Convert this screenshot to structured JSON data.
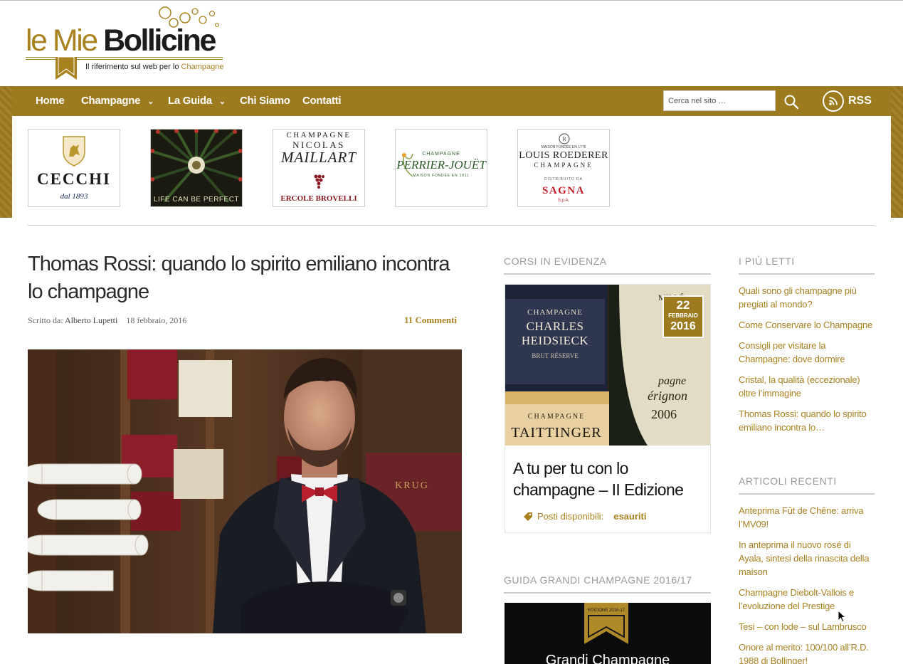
{
  "site": {
    "logo": {
      "word1": "le Mie ",
      "word2": "Bollicine",
      "tagline_prefix": "Il riferimento sul web per lo ",
      "tagline_highlight": "Champagne"
    }
  },
  "nav": {
    "items": [
      {
        "label": "Home",
        "has_submenu": false
      },
      {
        "label": "Champagne",
        "has_submenu": true
      },
      {
        "label": "La Guida",
        "has_submenu": true
      },
      {
        "label": "Chi Siamo",
        "has_submenu": false
      },
      {
        "label": "Contatti",
        "has_submenu": false
      }
    ],
    "search_placeholder": "Cerca nel sito …",
    "rss_label": "RSS"
  },
  "sponsors": {
    "cecchi": {
      "name": "CECCHI",
      "since": "dal 1893"
    },
    "perfect": {
      "text": "LIFE CAN BE PERFECT"
    },
    "maillart": {
      "line1": "CHAMPAGNE",
      "line2": "NICOLAS",
      "line3": "MAILLART",
      "line4": "ERCOLE BROVELLI"
    },
    "perrier": {
      "line1": "CHAMPAGNE",
      "line2": "PERRIER-JOUËT",
      "line3": "MAISON FONDÉE EN 1811"
    },
    "roederer": {
      "line0": "MAISON FONDÉE EN 1776",
      "line1": "LOUIS ROEDERER",
      "line2": "CHAMPAGNE",
      "line3": "DISTRIBUITO DA",
      "line4": "SAGNA",
      "line5": "S.p.A."
    }
  },
  "article": {
    "title": "Thomas Rossi: quando lo spirito emiliano incontra lo champagne",
    "author_prefix": "Scritto da: ",
    "author": "Alberto Lupetti",
    "date": "18 febbraio, 2016",
    "comments": "11 Commenti"
  },
  "courses_widget": {
    "title": "CORSI IN EVIDENZA",
    "badge": {
      "day": "22",
      "month": "FEBBRAIO",
      "year": "2016"
    },
    "course_title": "A tu per tu con lo champagne – II Edizione",
    "seats_label": "Posti disponibili:",
    "seats_value": "esauriti"
  },
  "guide_widget": {
    "title": "GUIDA GRANDI CHAMPAGNE 2016/17",
    "badge_text": "EDIZIONE 2016-17",
    "cover_text": "Grandi Champagne"
  },
  "most_read": {
    "title": "I PIÙ LETTI",
    "items": [
      "Quali sono gli champagne più pregiati al mondo?",
      "Come Conservare lo Champagne",
      "Consigli per visitare la Champagne: dove dormire",
      "Cristal, la qualità (eccezionale) oltre l’immagine",
      "Thomas Rossi: quando lo spirito emiliano incontra lo…"
    ]
  },
  "recent": {
    "title": "ARTICOLI RECENTI",
    "items": [
      "Anteprima Fût de Chêne: arriva l’MV09!",
      "In anteprima il nuovo rosé di Ayala, sintesi della rinascita della maison",
      "Champagne Diebolt-Vallois e l’evoluzione del Prestige",
      "Tesi – con lode – sul Lambrusco",
      "Onore al merito: 100/100 all’R.D. 1988 di Bollinger!"
    ]
  },
  "colors": {
    "gold": "#9c7a1e",
    "link_gold": "#a8821f",
    "text_dark": "#2a2a2a",
    "widget_grey": "#999999"
  }
}
